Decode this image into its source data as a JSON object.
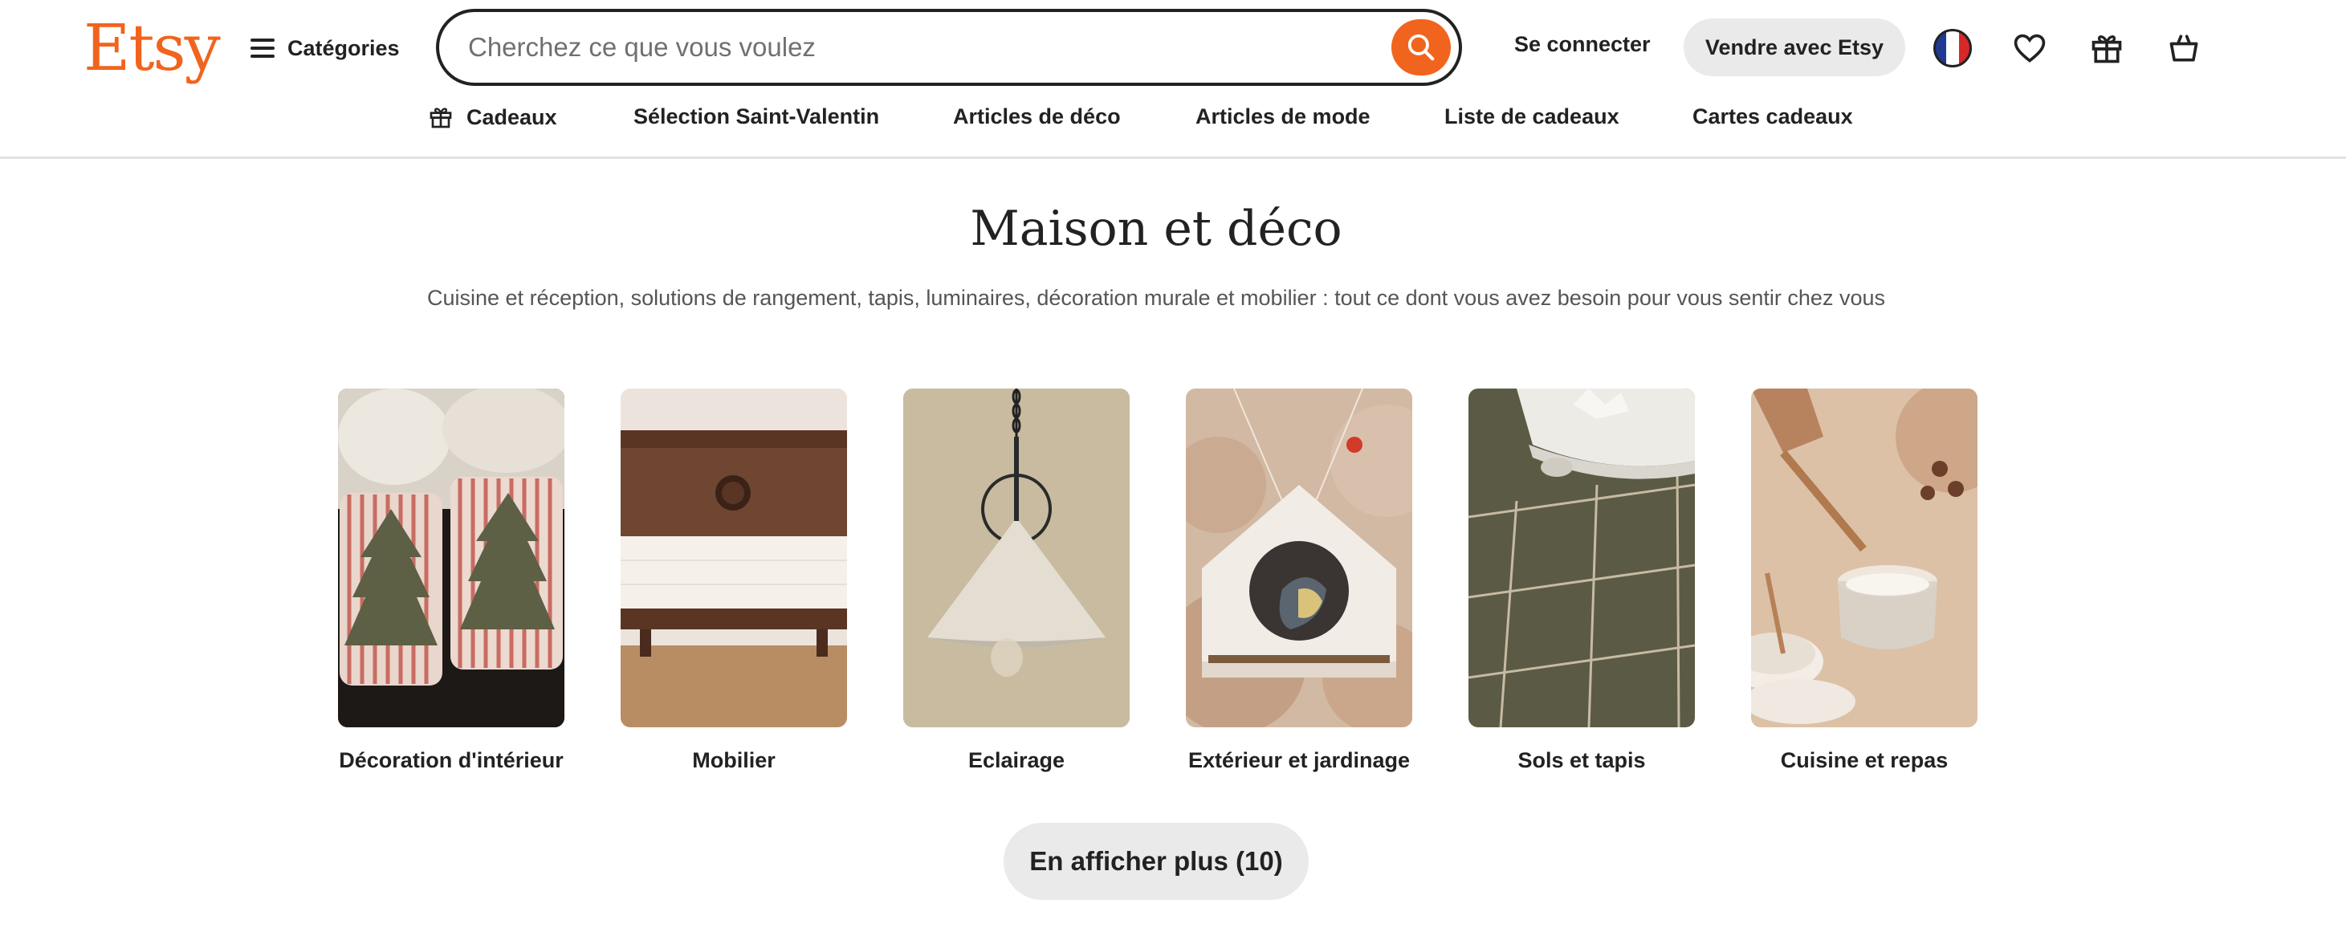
{
  "header": {
    "logo": "Etsy",
    "categories_label": "Catégories",
    "search_placeholder": "Cherchez ce que vous voulez",
    "signin_label": "Se connecter",
    "sell_label": "Vendre avec Etsy",
    "icons": [
      "hamburger-icon",
      "search-icon",
      "flag-france-icon",
      "heart-icon",
      "gift-icon",
      "cart-icon"
    ],
    "brand_color": "#f1641e"
  },
  "subnav": {
    "items": [
      {
        "label": "Cadeaux",
        "icon": "gift-icon"
      },
      {
        "label": "Sélection Saint-Valentin"
      },
      {
        "label": "Articles de déco"
      },
      {
        "label": "Articles de mode"
      },
      {
        "label": "Liste de cadeaux"
      },
      {
        "label": "Cartes cadeaux"
      }
    ]
  },
  "main": {
    "title": "Maison et déco",
    "subtitle": "Cuisine et réception, solutions de rangement, tapis, luminaires, décoration murale et mobilier : tout ce dont vous avez besoin pour vous sentir chez vous",
    "categories": [
      {
        "label": "Décoration d'intérieur"
      },
      {
        "label": "Mobilier"
      },
      {
        "label": "Eclairage"
      },
      {
        "label": "Extérieur et jardinage"
      },
      {
        "label": "Sols et tapis"
      },
      {
        "label": "Cuisine et repas"
      }
    ],
    "more_button": "En afficher plus (10)"
  }
}
